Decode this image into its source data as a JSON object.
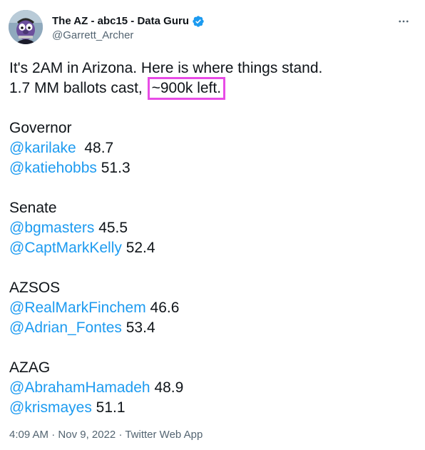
{
  "author": {
    "display_name": "The AZ - abc15 - Data Guru",
    "handle": "@Garrett_Archer",
    "verified": true
  },
  "tweet": {
    "intro_line": "It's 2AM in Arizona. Here is where things stand.",
    "ballots_prefix": "1.7 MM ballots cast, ",
    "ballots_highlight": "~900k left.",
    "races": [
      {
        "title": "Governor",
        "candidates": [
          {
            "mention": "@karilake",
            "value": "48.7"
          },
          {
            "mention": "@katiehobbs",
            "value": "51.3"
          }
        ]
      },
      {
        "title": "Senate",
        "candidates": [
          {
            "mention": "@bgmasters",
            "value": "45.5"
          },
          {
            "mention": "@CaptMarkKelly",
            "value": "52.4"
          }
        ]
      },
      {
        "title": "AZSOS",
        "candidates": [
          {
            "mention": "@RealMarkFinchem",
            "value": "46.6"
          },
          {
            "mention": "@Adrian_Fontes",
            "value": "53.4"
          }
        ]
      },
      {
        "title": "AZAG",
        "candidates": [
          {
            "mention": "@AbrahamHamadeh",
            "value": "48.9"
          },
          {
            "mention": "@krismayes",
            "value": "51.1"
          }
        ]
      }
    ]
  },
  "footer": {
    "time": "4:09 AM",
    "separator": " · ",
    "date": "Nov 9, 2022",
    "source": "Twitter Web App"
  },
  "colors": {
    "link": "#1d9bf0",
    "highlight_border": "#e84ce6",
    "secondary_text": "#536471"
  },
  "icons": {
    "verified": "verified-badge-icon",
    "more": "more-options-icon"
  }
}
